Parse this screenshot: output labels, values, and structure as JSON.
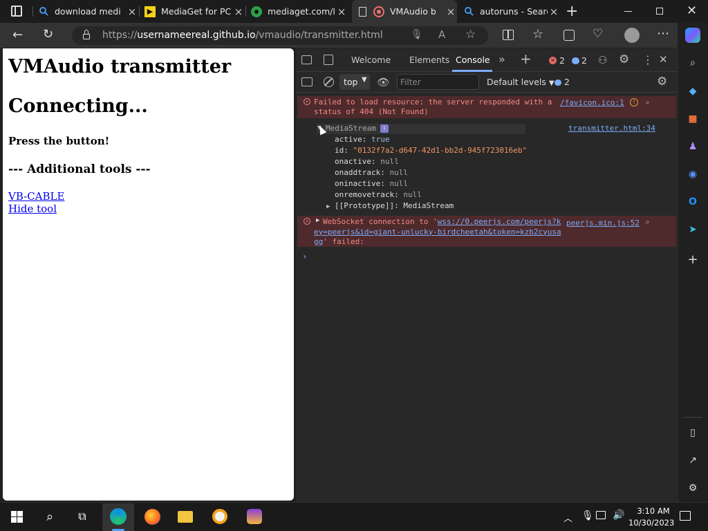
{
  "tabs": [
    {
      "label": "download medi"
    },
    {
      "label": "MediaGet for PC"
    },
    {
      "label": "mediaget.com/l"
    },
    {
      "label": "VMAudio b"
    },
    {
      "label": "autoruns - Searc"
    }
  ],
  "address": {
    "url_prefix": "https://",
    "url_host": "usernameereal.github.io",
    "url_path": "/vmaudio/transmitter.html"
  },
  "page": {
    "title": "VMAudio transmitter",
    "status": "Connecting...",
    "press": "Press the button!",
    "tools_heading": "--- Additional tools ---",
    "link1": "VB-CABLE",
    "link2": "Hide tool"
  },
  "devtools": {
    "tabs": [
      "Welcome",
      "Elements",
      "Console"
    ],
    "error_count": "2",
    "message_count": "2",
    "context": "top",
    "filter_placeholder": "Filter",
    "levels": "Default levels",
    "issues_count": "2",
    "err1_text": "Failed to load resource: the server responded with a status of 404 (Not Found)",
    "err1_source": "/favicon.ico:1",
    "obj_label": "MediaStream",
    "obj_source": "transmitter.html:34",
    "props": [
      {
        "key": "active:",
        "val": "true"
      },
      {
        "key": "id:",
        "val": "\"0132f7a2-d647-42d1-bb2d-945f723016eb\""
      },
      {
        "key": "onactive:",
        "val": "null"
      },
      {
        "key": "onaddtrack:",
        "val": "null"
      },
      {
        "key": "oninactive:",
        "val": "null"
      },
      {
        "key": "onremovetrack:",
        "val": "null"
      }
    ],
    "proto_key": "[[Prototype]]:",
    "proto_val": "MediaStream",
    "err2_pre": "WebSocket connection to '",
    "err2_link": "wss://0.peerjs.com/peerjs?key=peerjs&id=giant-unlucky-birdcheetah&token=kzb2cyusagg",
    "err2_post": "' failed:",
    "err2_source": "peerjs.min.js:52"
  },
  "taskbar": {
    "time": "3:10 AM",
    "date": "10/30/2023"
  },
  "colors": {
    "accent": "#7cacf8",
    "error_bg": "#4e2a2d",
    "error_text": "#f28b82"
  }
}
